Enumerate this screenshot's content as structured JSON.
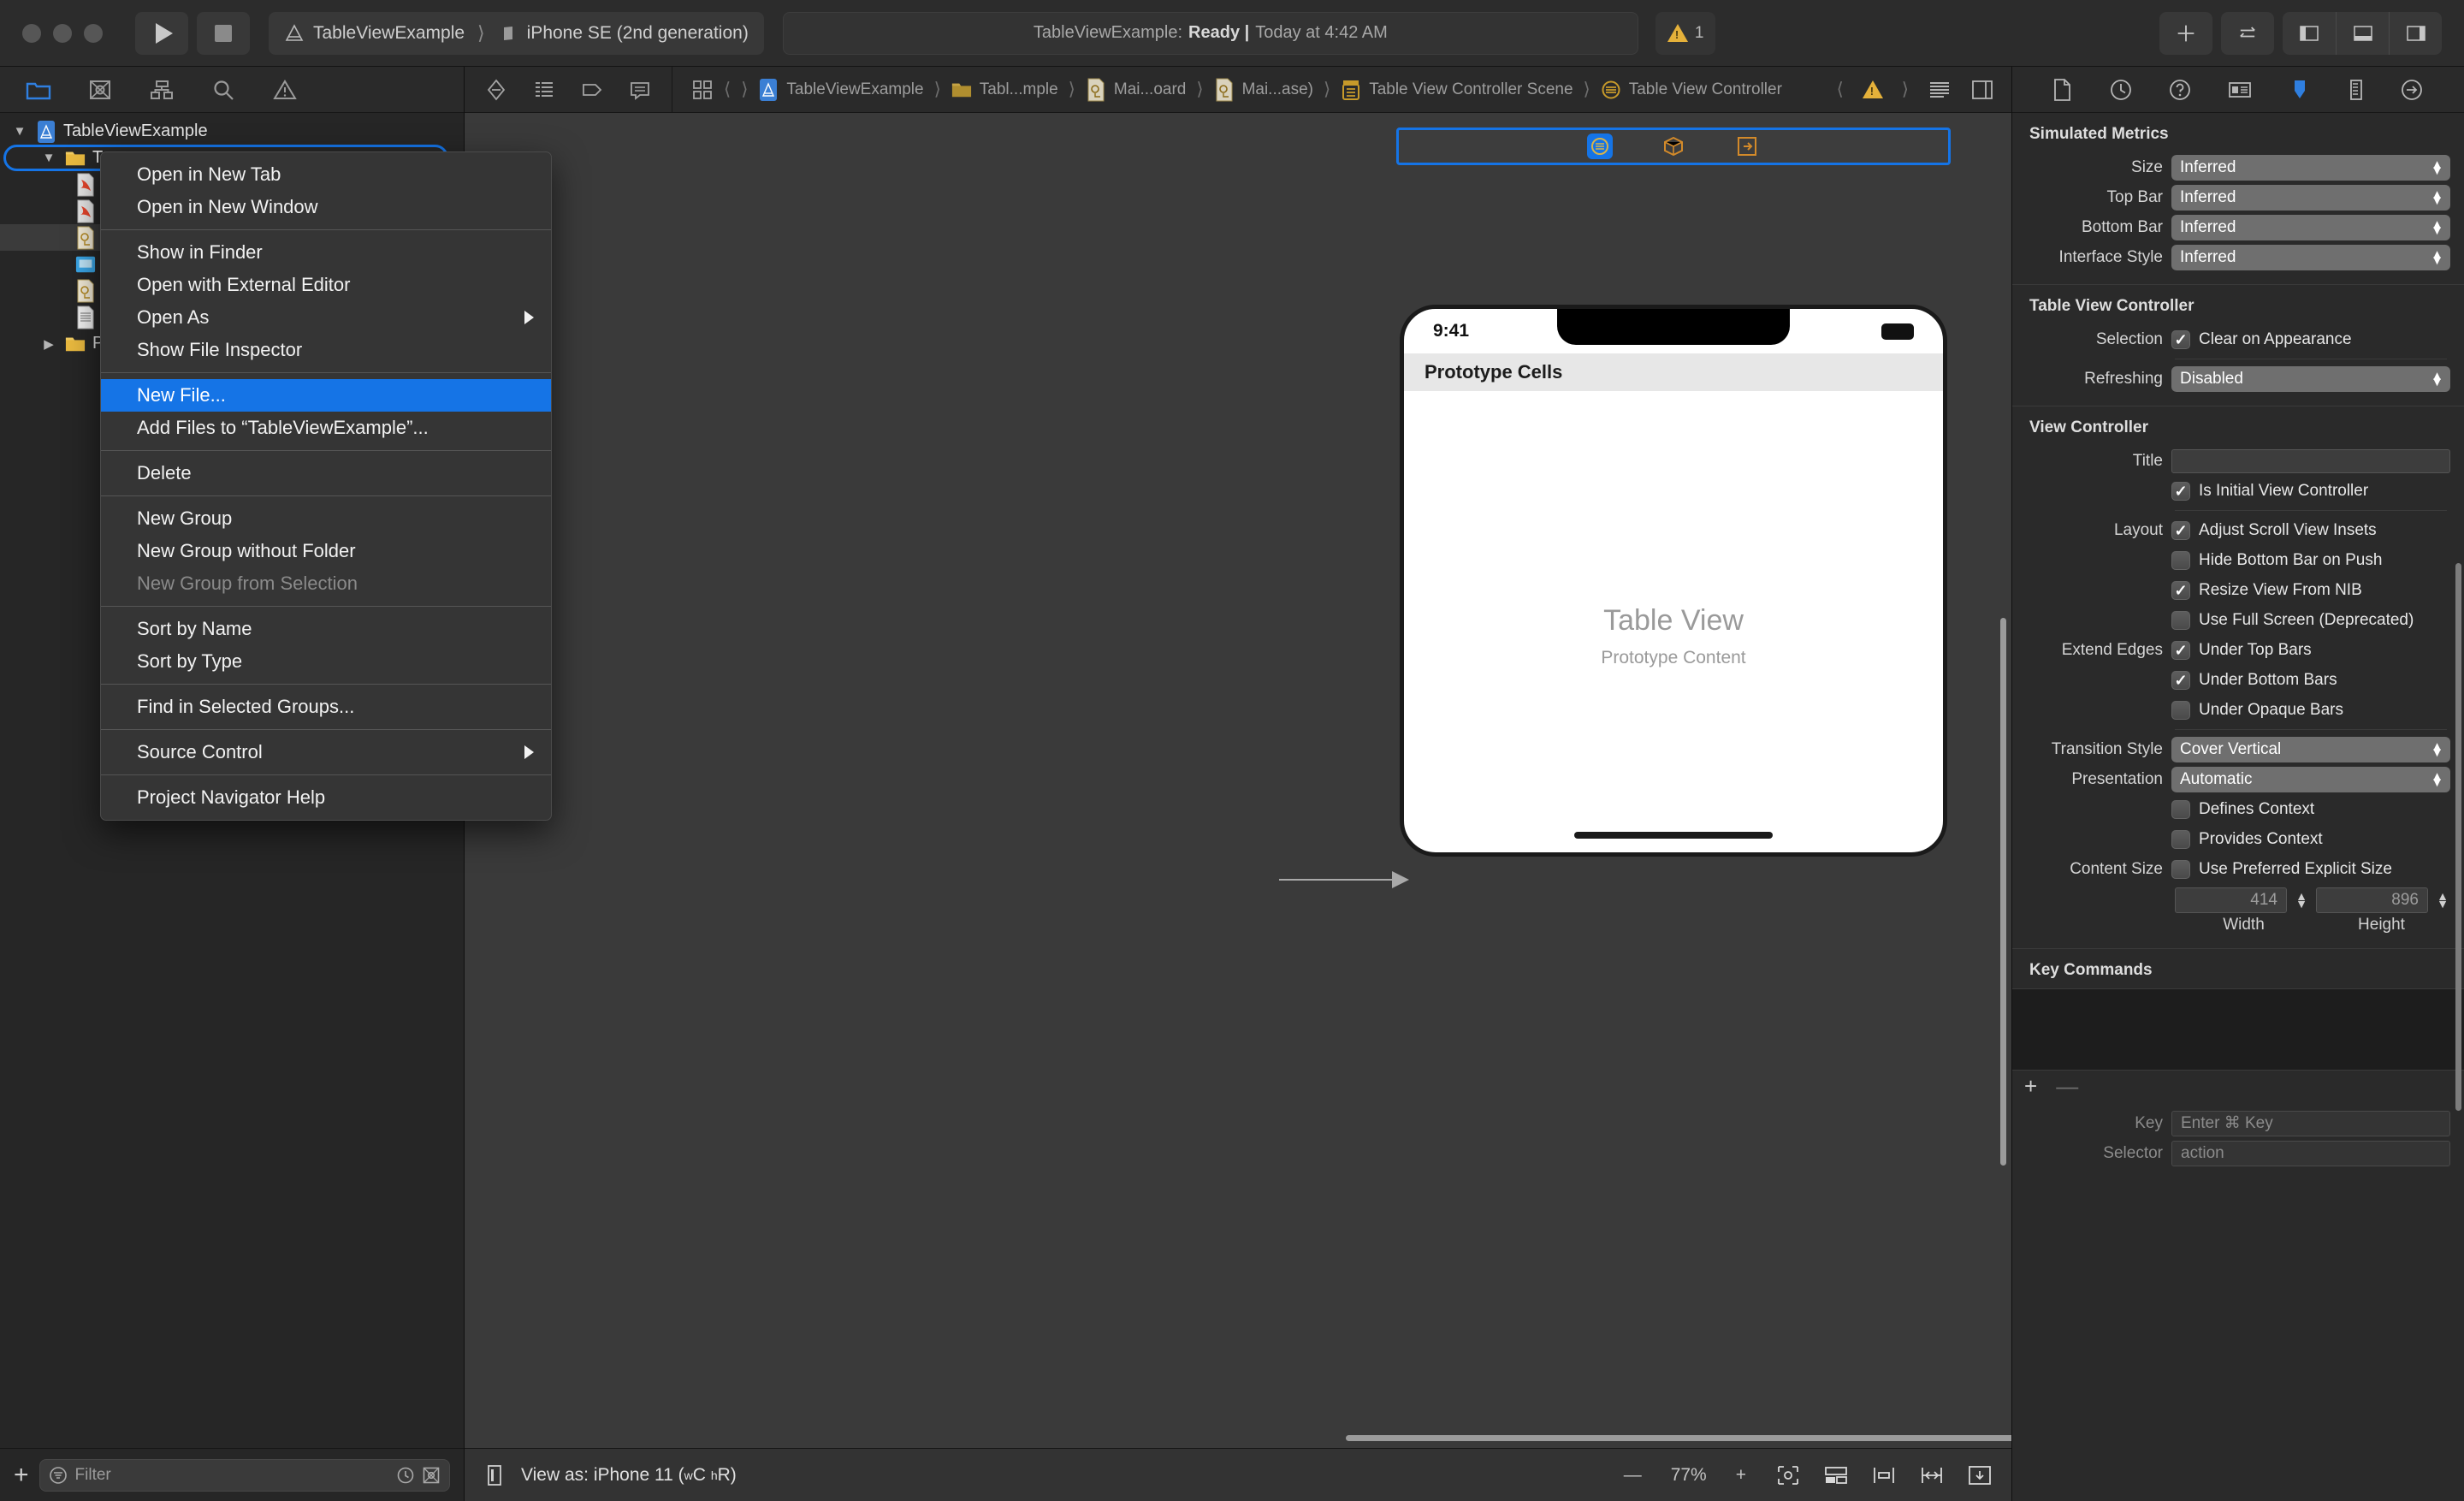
{
  "toolbar": {
    "scheme_name": "TableViewExample",
    "destination": "iPhone SE (2nd generation)",
    "status_prefix": "TableViewExample:",
    "status_state": "Ready |",
    "status_time": "Today at 4:42 AM",
    "warning_count": "1",
    "add_label": "+",
    "icons": {
      "run": "play-icon",
      "stop": "stop-icon",
      "add": "plus-icon",
      "swap": "swap-arrows-icon",
      "left_panel": "left-panel-toggle-icon",
      "bottom_panel": "bottom-panel-toggle-icon",
      "right_panel": "right-panel-toggle-icon"
    }
  },
  "navigator": {
    "tabs": [
      "project-navigator-icon",
      "source-control-navigator-icon",
      "symbol-navigator-icon",
      "find-navigator-icon",
      "issue-navigator-icon"
    ],
    "tree": [
      {
        "name": "TableViewExample",
        "indent": 0,
        "twisty": "▼",
        "icon": "xcode-project-icon"
      },
      {
        "name": "Ta",
        "indent": 1,
        "twisty": "▼",
        "icon": "folder-icon"
      },
      {
        "name": "",
        "indent": 2,
        "twisty": "",
        "icon": "swift-file-icon"
      },
      {
        "name": "",
        "indent": 2,
        "twisty": "",
        "icon": "swift-file-icon"
      },
      {
        "name": "",
        "indent": 2,
        "twisty": "",
        "icon": "storyboard-file-icon"
      },
      {
        "name": "",
        "indent": 2,
        "twisty": "",
        "icon": "assets-file-icon"
      },
      {
        "name": "",
        "indent": 2,
        "twisty": "",
        "icon": "storyboard-file-icon"
      },
      {
        "name": "",
        "indent": 2,
        "twisty": "",
        "icon": "plist-file-icon"
      },
      {
        "name": "P",
        "indent": 1,
        "twisty": "▶",
        "icon": "folder-icon"
      }
    ],
    "filter_placeholder": "Filter",
    "filter_icons": [
      "recent-icon",
      "clear-icon"
    ]
  },
  "context_menu": {
    "groups": [
      [
        {
          "label": "Open in New Tab"
        },
        {
          "label": "Open in New Window"
        }
      ],
      [
        {
          "label": "Show in Finder"
        },
        {
          "label": "Open with External Editor"
        },
        {
          "label": "Open As",
          "submenu": true
        },
        {
          "label": "Show File Inspector"
        }
      ],
      [
        {
          "label": "New File...",
          "highlighted": true
        },
        {
          "label": "Add Files to “TableViewExample”..."
        }
      ],
      [
        {
          "label": "Delete"
        }
      ],
      [
        {
          "label": "New Group"
        },
        {
          "label": "New Group without Folder"
        },
        {
          "label": "New Group from Selection",
          "disabled": true
        }
      ],
      [
        {
          "label": "Sort by Name"
        },
        {
          "label": "Sort by Type"
        }
      ],
      [
        {
          "label": "Find in Selected Groups..."
        }
      ],
      [
        {
          "label": "Source Control",
          "submenu": true
        }
      ],
      [
        {
          "label": "Project Navigator Help"
        }
      ]
    ]
  },
  "editor": {
    "jump_bar_icons": [
      "related-items-icon",
      "document-items-icon",
      "previous-icon",
      "next-icon"
    ],
    "breadcrumbs": [
      {
        "label": "TableViewExample",
        "icon": "xcode-project-icon"
      },
      {
        "label": "Tabl...mple",
        "icon": "folder-icon"
      },
      {
        "label": "Mai...oard",
        "icon": "storyboard-file-icon"
      },
      {
        "label": "Mai...ase)",
        "icon": "storyboard-file-icon"
      },
      {
        "label": "Table View Controller Scene",
        "icon": "scene-icon"
      },
      {
        "label": "Table View Controller",
        "icon": "view-controller-icon"
      }
    ],
    "jump_bar_right_icons": [
      "back-icon",
      "warning-icon",
      "forward-icon",
      "minimap-icon",
      "assistant-editor-icon"
    ],
    "scene_dock_icons": [
      "view-controller-icon",
      "first-responder-icon",
      "exit-icon"
    ],
    "phone": {
      "time": "9:41",
      "section_header": "Prototype Cells",
      "placeholder_title": "Table View",
      "placeholder_subtitle": "Prototype Content"
    },
    "canvas_bar": {
      "view_as_label": "View as: iPhone 11 (",
      "view_as_w": "w",
      "view_as_wval": "C",
      "view_as_h": "h",
      "view_as_hval": "R",
      "view_as_close": ")",
      "zoom_out": "—",
      "zoom_level": "77%",
      "zoom_in": "+",
      "icons": [
        "device-icon",
        "align-icon",
        "embed-icon",
        "resolve-issues-icon",
        "add-constraints-icon",
        "update-frames-icon"
      ]
    }
  },
  "inspector": {
    "tabs": [
      "file-inspector-icon",
      "history-inspector-icon",
      "quick-help-icon",
      "identity-inspector-icon",
      "attributes-inspector-icon",
      "size-inspector-icon",
      "connections-inspector-icon"
    ],
    "sections": [
      {
        "title": "Simulated Metrics",
        "rows": [
          {
            "type": "popup",
            "label": "Size",
            "value": "Inferred"
          },
          {
            "type": "popup",
            "label": "Top Bar",
            "value": "Inferred"
          },
          {
            "type": "popup",
            "label": "Bottom Bar",
            "value": "Inferred"
          },
          {
            "type": "popup",
            "label": "Interface Style",
            "value": "Inferred"
          }
        ]
      },
      {
        "title": "Table View Controller",
        "rows": [
          {
            "type": "check",
            "label": "Selection",
            "value": "Clear on Appearance",
            "checked": true
          },
          {
            "type": "popup",
            "label": "Refreshing",
            "value": "Disabled"
          }
        ]
      },
      {
        "title": "View Controller",
        "rows": [
          {
            "type": "text",
            "label": "Title",
            "value": ""
          },
          {
            "type": "check",
            "label": "",
            "value": "Is Initial View Controller",
            "checked": true
          },
          {
            "type": "check",
            "label": "Layout",
            "value": "Adjust Scroll View Insets",
            "checked": true
          },
          {
            "type": "check",
            "label": "",
            "value": "Hide Bottom Bar on Push",
            "checked": false
          },
          {
            "type": "check",
            "label": "",
            "value": "Resize View From NIB",
            "checked": true
          },
          {
            "type": "check",
            "label": "",
            "value": "Use Full Screen (Deprecated)",
            "checked": false
          },
          {
            "type": "check",
            "label": "Extend Edges",
            "value": "Under Top Bars",
            "checked": true
          },
          {
            "type": "check",
            "label": "",
            "value": "Under Bottom Bars",
            "checked": true
          },
          {
            "type": "check",
            "label": "",
            "value": "Under Opaque Bars",
            "checked": false
          },
          {
            "type": "popup",
            "label": "Transition Style",
            "value": "Cover Vertical"
          },
          {
            "type": "popup",
            "label": "Presentation",
            "value": "Automatic"
          },
          {
            "type": "check",
            "label": "",
            "value": "Defines Context",
            "checked": false
          },
          {
            "type": "check",
            "label": "",
            "value": "Provides Context",
            "checked": false
          },
          {
            "type": "check",
            "label": "Content Size",
            "value": "Use Preferred Explicit Size",
            "checked": false
          }
        ],
        "size_fields": {
          "width_value": "414",
          "height_value": "896",
          "width_caption": "Width",
          "height_caption": "Height"
        }
      },
      {
        "title": "Key Commands",
        "add_label": "+",
        "remove_label": "—",
        "rows": [
          {
            "type": "placeholder",
            "label": "Key",
            "value": "Enter ⌘ Key"
          },
          {
            "type": "placeholder",
            "label": "Selector",
            "value": "action"
          }
        ]
      }
    ]
  },
  "colors": {
    "accent": "#1574e6",
    "warning": "#e5b13a",
    "toolbar_bg": "#2c2c2c",
    "panel_bg": "#2a2a2a",
    "canvas_bg": "#3a3a3a"
  }
}
